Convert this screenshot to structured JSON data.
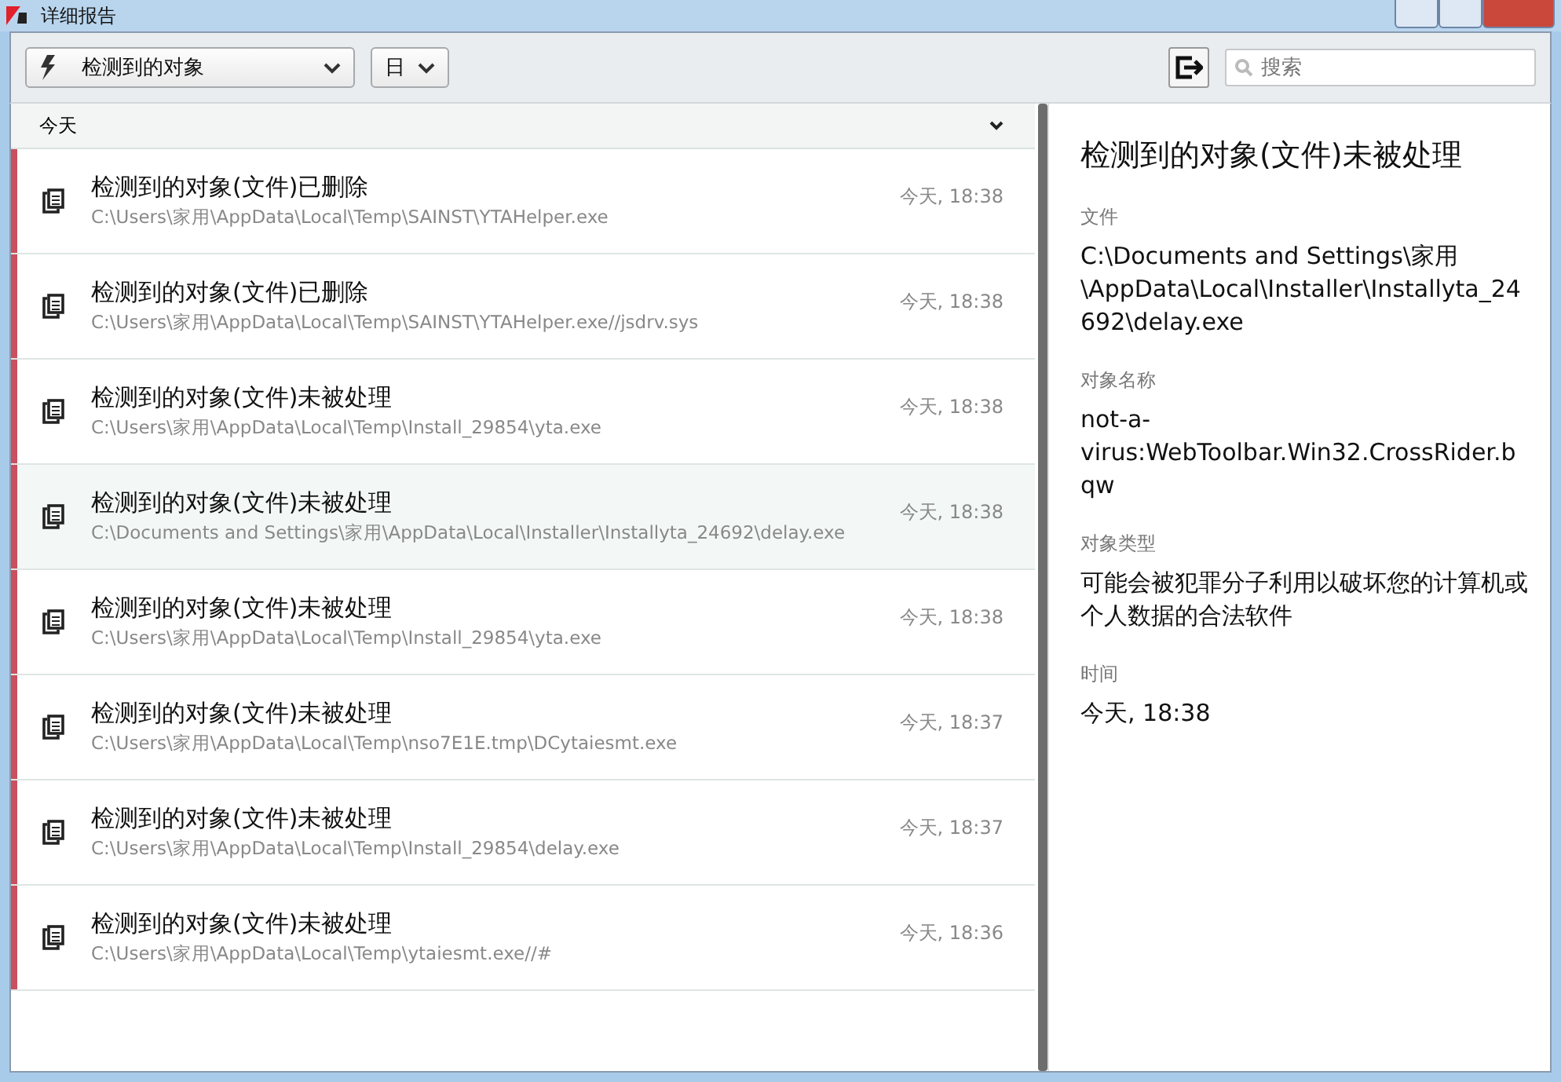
{
  "window": {
    "title": "详细报告"
  },
  "toolbar": {
    "filter": "检测到的对象",
    "period": "日",
    "search": {
      "placeholder": "搜索"
    }
  },
  "list": {
    "group": "今天",
    "rows": [
      {
        "title": "检测到的对象(文件)已删除",
        "path": "C:\\Users\\家用\\AppData\\Local\\Temp\\SAINST\\YTAHelper.exe",
        "time": "今天, 18:38",
        "selected": false,
        "color": "#c8505f"
      },
      {
        "title": "检测到的对象(文件)已删除",
        "path": "C:\\Users\\家用\\AppData\\Local\\Temp\\SAINST\\YTAHelper.exe//jsdrv.sys",
        "time": "今天, 18:38",
        "selected": false,
        "color": "#c8505f"
      },
      {
        "title": "检测到的对象(文件)未被处理",
        "path": "C:\\Users\\家用\\AppData\\Local\\Temp\\Install_29854\\yta.exe",
        "time": "今天, 18:38",
        "selected": false,
        "color": "#c8505f"
      },
      {
        "title": "检测到的对象(文件)未被处理",
        "path": "C:\\Documents and Settings\\家用\\AppData\\Local\\Installer\\Installyta_24692\\delay.exe",
        "time": "今天, 18:38",
        "selected": true,
        "color": "#c8505f"
      },
      {
        "title": "检测到的对象(文件)未被处理",
        "path": "C:\\Users\\家用\\AppData\\Local\\Temp\\Install_29854\\yta.exe",
        "time": "今天, 18:38",
        "selected": false,
        "color": "#c8505f"
      },
      {
        "title": "检测到的对象(文件)未被处理",
        "path": "C:\\Users\\家用\\AppData\\Local\\Temp\\nso7E1E.tmp\\DCytaiesmt.exe",
        "time": "今天, 18:37",
        "selected": false,
        "color": "#c8505f"
      },
      {
        "title": "检测到的对象(文件)未被处理",
        "path": "C:\\Users\\家用\\AppData\\Local\\Temp\\Install_29854\\delay.exe",
        "time": "今天, 18:37",
        "selected": false,
        "color": "#c8505f"
      },
      {
        "title": "检测到的对象(文件)未被处理",
        "path": "C:\\Users\\家用\\AppData\\Local\\Temp\\ytaiesmt.exe//#",
        "time": "今天, 18:36",
        "selected": false,
        "color": "#c8505f"
      }
    ]
  },
  "detail": {
    "title": "检测到的对象(文件)未被处理",
    "fields": [
      {
        "label": "文件",
        "value": "C:\\Documents and Settings\\家用\\AppData\\Local\\Installer\\Installyta_24692\\delay.exe"
      },
      {
        "label": "对象名称",
        "value": "not-a-virus:WebToolbar.Win32.CrossRider.bqw"
      },
      {
        "label": "对象类型",
        "value": "可能会被犯罪分子利用以破坏您的计算机或个人数据的合法软件"
      },
      {
        "label": "时间",
        "value": "今天, 18:38"
      }
    ]
  }
}
